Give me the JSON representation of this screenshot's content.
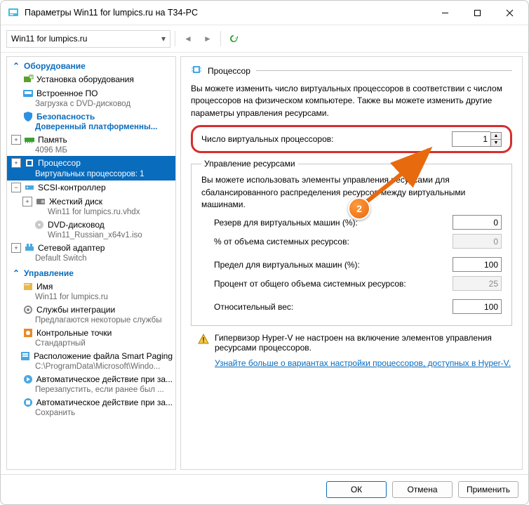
{
  "window": {
    "title": "Параметры Win11 for lumpics.ru на T34-PC"
  },
  "vm_selector": {
    "value": "Win11 for lumpics.ru"
  },
  "tree": {
    "h_hardware": "Оборудование",
    "add_hw": "Установка оборудования",
    "firmware": "Встроенное ПО",
    "firmware_sub": "Загрузка с DVD-дисковод",
    "security": "Безопасность",
    "security_sub": "Доверенный платформенны...",
    "memory": "Память",
    "memory_sub": "4096 МБ",
    "cpu": "Процессор",
    "cpu_sub": "Виртуальных процессоров: 1",
    "scsi": "SCSI-контроллер",
    "hdd": "Жесткий диск",
    "hdd_sub": "Win11 for lumpics.ru.vhdx",
    "dvd": "DVD-дисковод",
    "dvd_sub": "Win11_Russian_x64v1.iso",
    "net": "Сетевой адаптер",
    "net_sub": "Default Switch",
    "h_mgmt": "Управление",
    "name": "Имя",
    "name_sub": "Win11 for lumpics.ru",
    "integ": "Службы интеграции",
    "integ_sub": "Предлагаются некоторые службы",
    "chk": "Контрольные точки",
    "chk_sub": "Стандартный",
    "sp": "Расположение файла Smart Paging",
    "sp_sub": "C:\\ProgramData\\Microsoft\\Windo...",
    "auto1": "Автоматическое действие при за...",
    "auto1_sub": "Перезапустить, если ранее был ...",
    "auto2": "Автоматическое действие при за...",
    "auto2_sub": "Сохранить"
  },
  "pane": {
    "title": "Процессор",
    "desc": "Вы можете изменить число виртуальных процессоров в соответствии с числом процессоров на физическом компьютере. Также вы можете изменить другие параметры управления ресурсами.",
    "vcpu_label": "Число виртуальных процессоров:",
    "vcpu_value": "1",
    "rm_legend": "Управление ресурсами",
    "rm_desc": "Вы можете использовать элементы управления ресурсами для сбалансированного распределения ресурсов между виртуальными машинами.",
    "reserve_label": "Резерв для виртуальных машин (%):",
    "reserve_val": "0",
    "pct_sys_label": "% от объема системных ресурсов:",
    "pct_sys_val": "0",
    "limit_label": "Предел для виртуальных машин (%):",
    "limit_val": "100",
    "pct_total_label": "Процент от общего объема системных ресурсов:",
    "pct_total_val": "25",
    "weight_label": "Относительный вес:",
    "weight_val": "100",
    "warn": "Гипервизор Hyper-V не настроен на включение элементов управления ресурсами процессоров.",
    "link": "Узнайте больше о вариантах настройки процессоров, доступных в Hyper-V."
  },
  "badge": "2",
  "footer": {
    "ok": "ОК",
    "cancel": "Отмена",
    "apply": "Применить"
  }
}
